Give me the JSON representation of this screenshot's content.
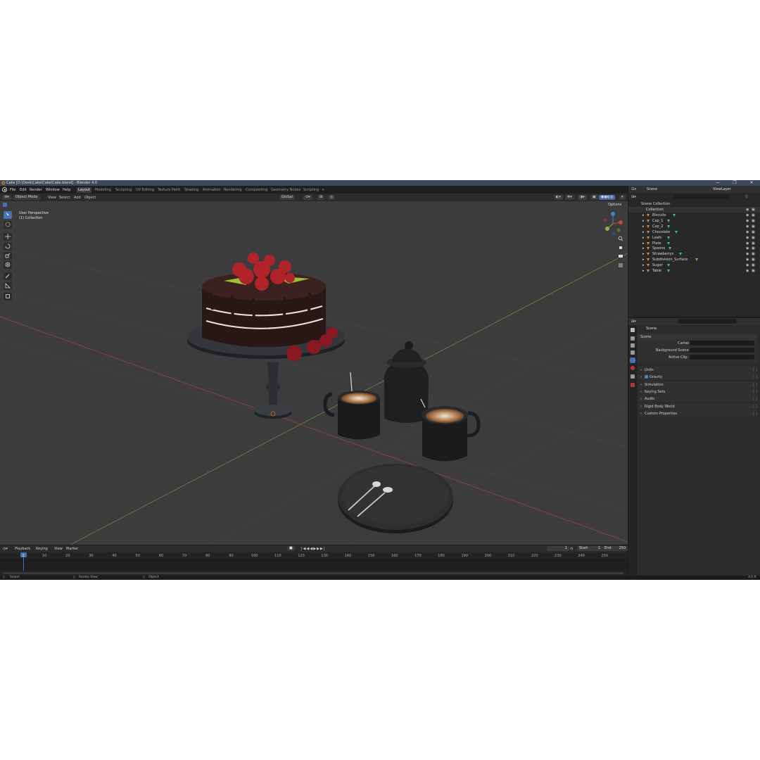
{
  "window": {
    "title": "Cake [D:\\Desk\\Cake\\Cake\\Cake.blend] - Blender 4.0",
    "controls": [
      "—",
      "❐",
      "✕"
    ]
  },
  "menu": [
    "File",
    "Edit",
    "Render",
    "Window",
    "Help"
  ],
  "workspaces": [
    "Layout",
    "Modeling",
    "Sculpting",
    "UV Editing",
    "Texture Paint",
    "Shading",
    "Animation",
    "Rendering",
    "Compositing",
    "Geometry Nodes",
    "Scripting",
    "+"
  ],
  "viewport": {
    "mode": "Object Mode",
    "menus": [
      "View",
      "Select",
      "Add",
      "Object"
    ],
    "transform_orientation": "Global",
    "options_label": "Options",
    "overlay_title": "User Perspective",
    "overlay_subtitle": "(1) Collection",
    "colors": {
      "x_axis": "#c4474d",
      "y_axis": "#8bb54a",
      "z_axis": "#4a7fd1",
      "grid": "#4a4a4a",
      "bg": "#3c3c3c"
    }
  },
  "outliner": {
    "scene_label": "Scene",
    "view_layer_label": "ViewLayer",
    "root": "Scene Collection",
    "collection": "Collection",
    "items": [
      "Biscuits",
      "Cap_1",
      "Cap_2",
      "Chocolate",
      "Leafs",
      "Plate",
      "Spoons",
      "Strawberrys",
      "Subdivision_Surface",
      "Sugar",
      "Table"
    ]
  },
  "properties": {
    "breadcrumb": "Scene",
    "panel_title": "Scene",
    "fields": [
      "Camera",
      "Background Scene",
      "Active Clip"
    ],
    "sections": [
      "Units",
      "Gravity",
      "Simulation",
      "Keying Sets",
      "Audio",
      "Rigid Body World",
      "Custom Properties"
    ],
    "gravity_checked": true
  },
  "timeline": {
    "menus": [
      "Playback",
      "Keying",
      "View",
      "Marker"
    ],
    "current_frame": "1",
    "start_label": "Start",
    "start": "1",
    "end_label": "End",
    "end": "250",
    "ruler": [
      "1",
      "10",
      "20",
      "30",
      "40",
      "50",
      "60",
      "70",
      "80",
      "90",
      "100",
      "110",
      "120",
      "130",
      "140",
      "150",
      "160",
      "170",
      "180",
      "190",
      "200",
      "210",
      "220",
      "230",
      "240",
      "250"
    ]
  },
  "status": {
    "select": "Select",
    "rotate": "Rotate View",
    "object": "Object",
    "version": "4.0.0"
  },
  "accent": "#4772b3"
}
